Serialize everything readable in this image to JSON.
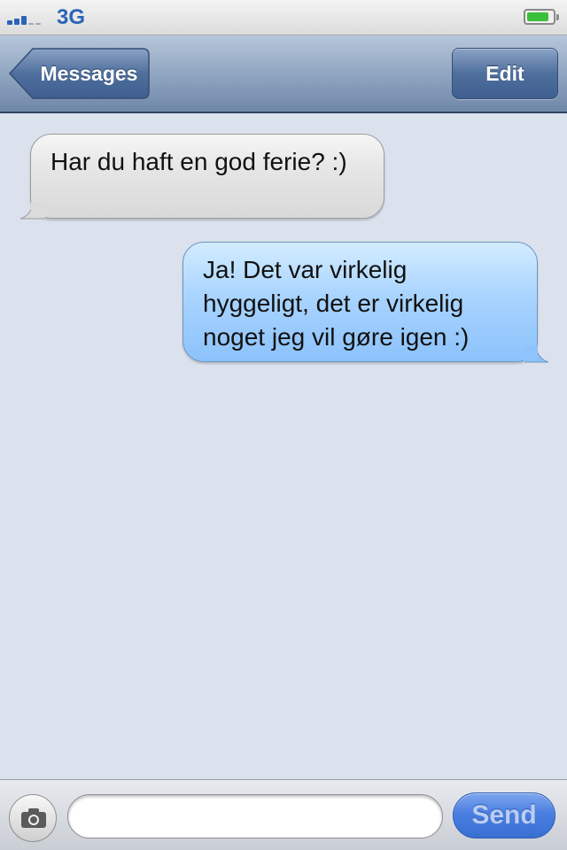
{
  "status_bar": {
    "network": "3G",
    "signal_bars": 3,
    "signal_bars_total": 5,
    "battery_level": 0.85,
    "signal_color": "#2b63b8",
    "battery_color": "#3cbf3a"
  },
  "nav": {
    "back_label": "Messages",
    "edit_label": "Edit"
  },
  "messages": [
    {
      "direction": "incoming",
      "text": "Har du haft en god ferie? :)"
    },
    {
      "direction": "outgoing",
      "text": "Ja! Det var virkelig hyggeligt, det er virkelig noget jeg vil gøre igen :)"
    }
  ],
  "composer": {
    "input_value": "",
    "send_label": "Send",
    "camera_icon": "camera-icon"
  }
}
